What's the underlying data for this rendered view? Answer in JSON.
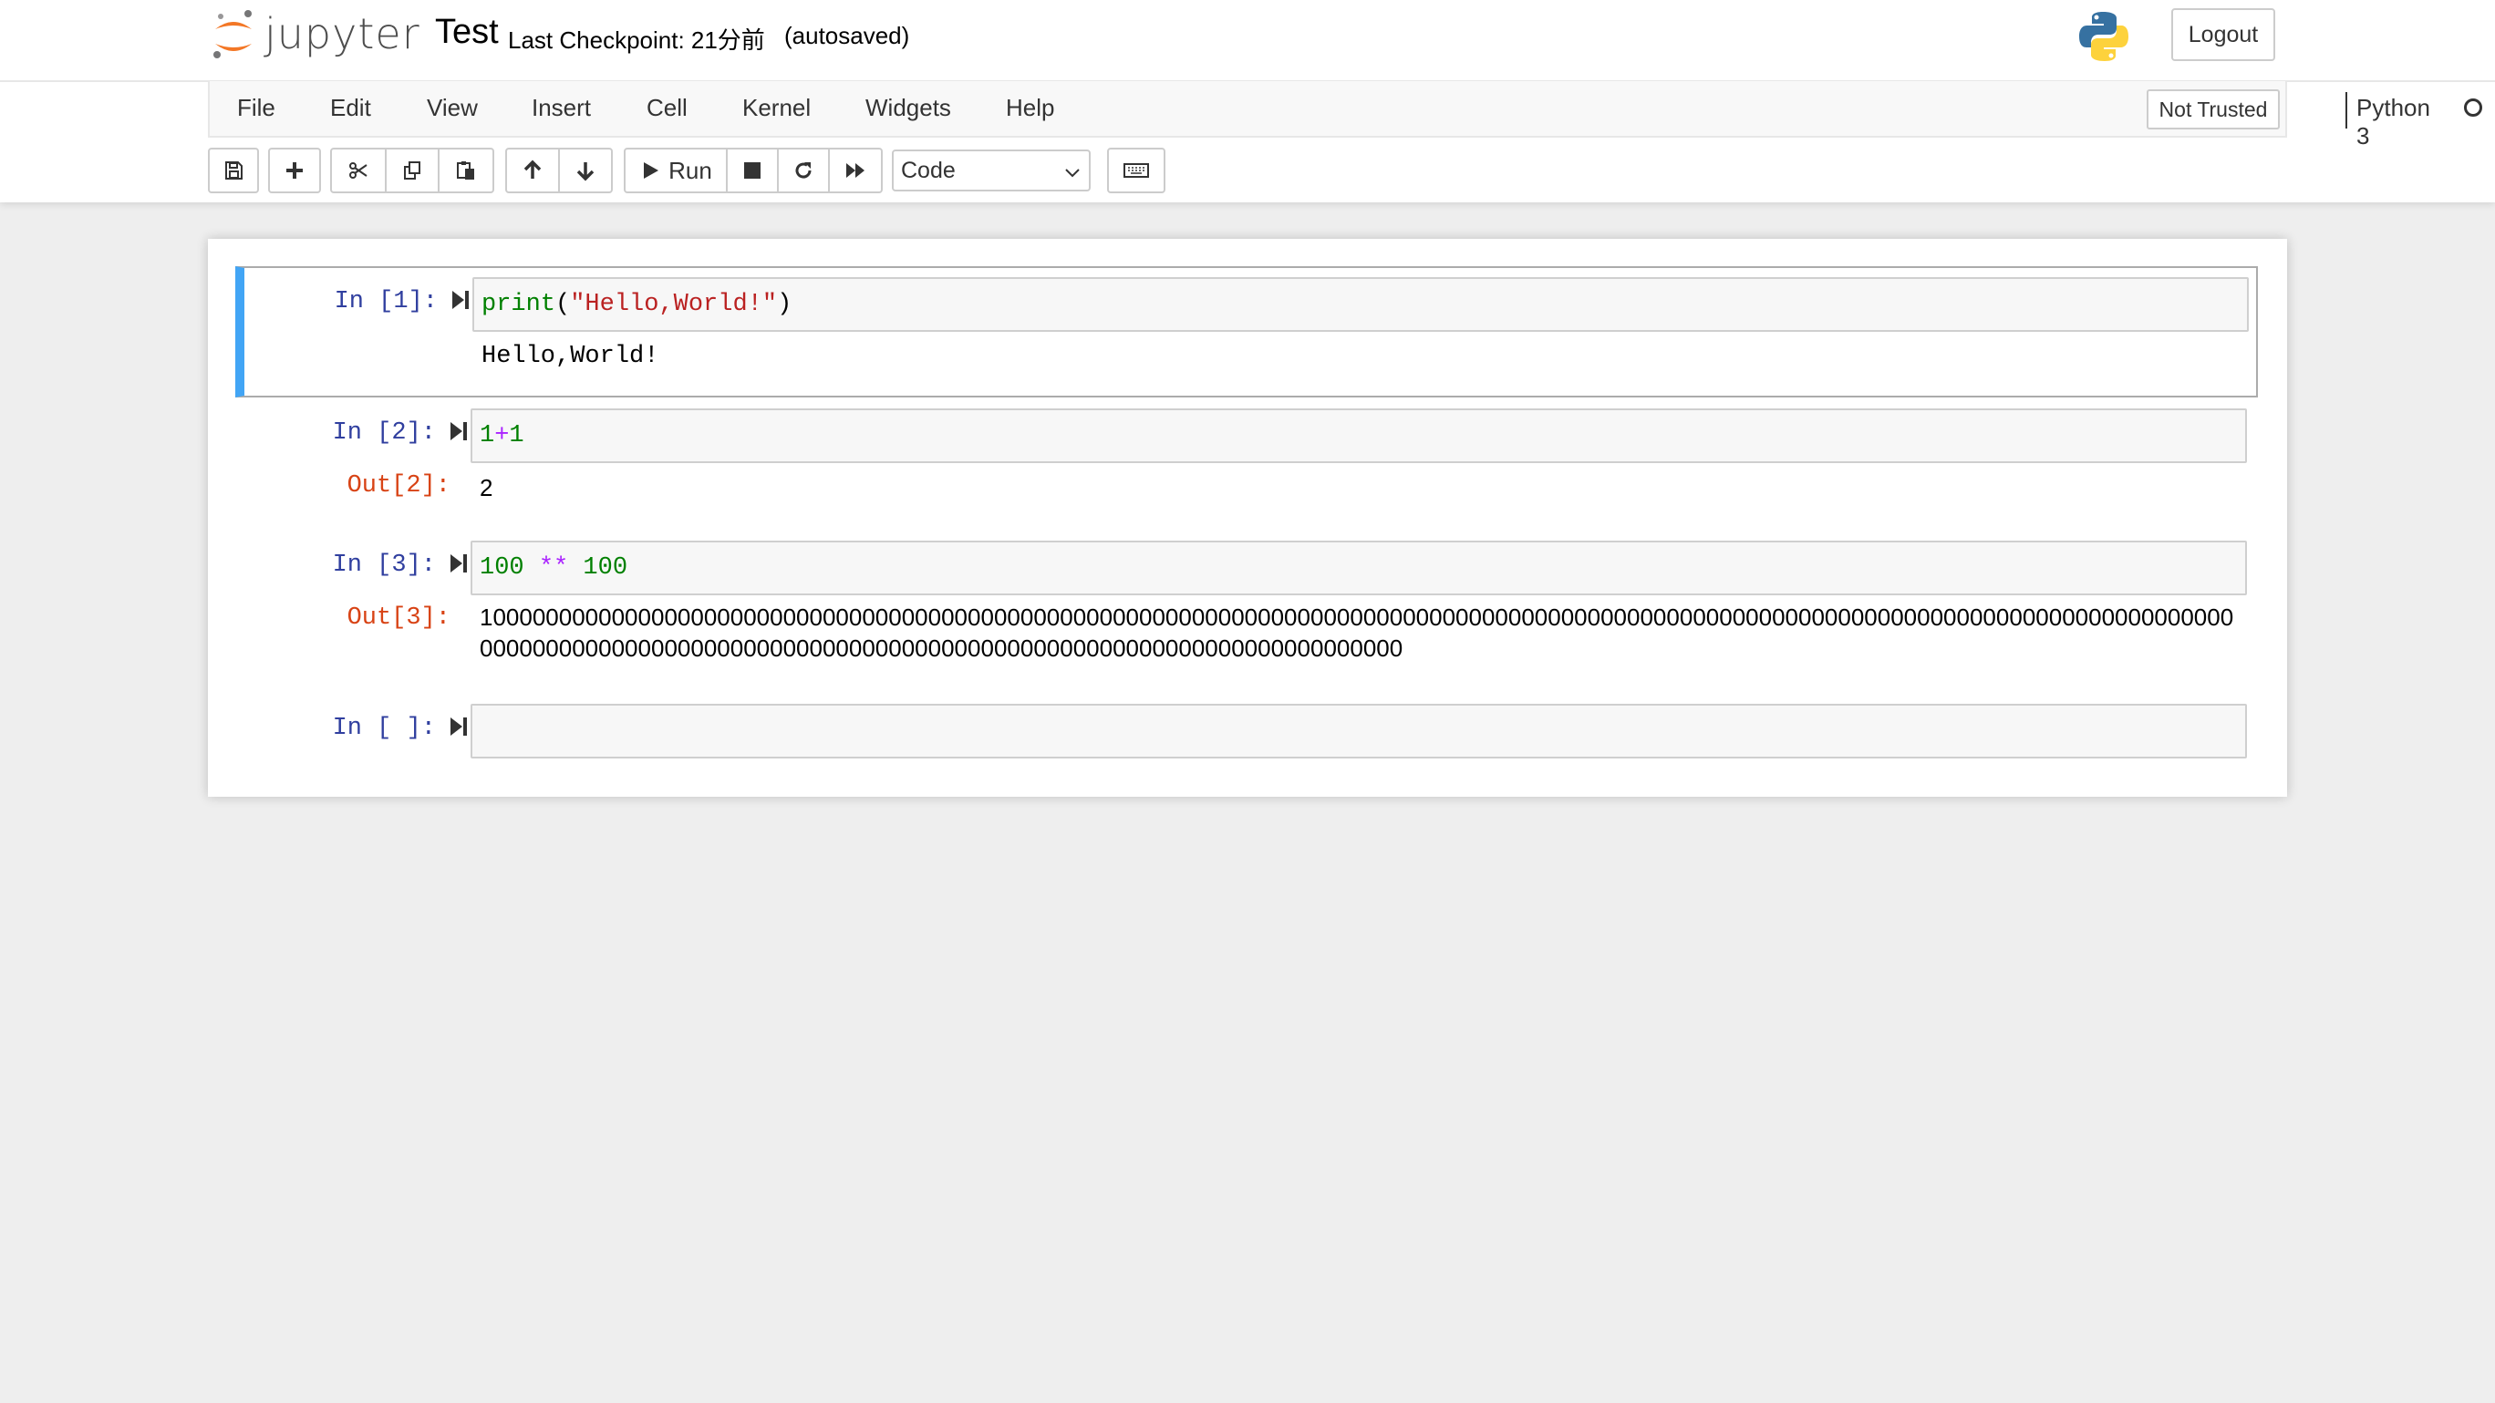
{
  "header": {
    "logo_text": "jupyter",
    "notebook_name": "Test",
    "checkpoint": "Last Checkpoint: 21分前",
    "autosave": "(autosaved)",
    "logout_label": "Logout"
  },
  "menubar": {
    "items": [
      "File",
      "Edit",
      "View",
      "Insert",
      "Cell",
      "Kernel",
      "Widgets",
      "Help"
    ],
    "trusted_label": "Not Trusted",
    "kernel_name": "Python 3"
  },
  "toolbar": {
    "run_label": "Run",
    "cell_type": "Code"
  },
  "cells": [
    {
      "in_prompt": "In [1]:",
      "code": {
        "fn": "print",
        "open": "(",
        "str": "\"Hello,World!\"",
        "close": ")"
      },
      "output": "Hello,World!"
    },
    {
      "in_prompt": "In [2]:",
      "code": {
        "a": "1",
        "op": "+",
        "b": "1"
      },
      "out_prompt": "Out[2]:",
      "output": "2"
    },
    {
      "in_prompt": "In [3]:",
      "code": {
        "a": "100",
        "op": "**",
        "b": "100"
      },
      "out_prompt": "Out[3]:",
      "output": "10000000000000000000000000000000000000000000000000000000000000000000000000000000000000000000000000000000000000000000000000000000000000000000000000000000000000000000000000000000000000000000000000000000000"
    },
    {
      "in_prompt": "In [ ]:"
    }
  ],
  "colors": {
    "selected_cell_border": "#42a5f5",
    "in_prompt": "#303f9f",
    "out_prompt": "#d84315",
    "builtin": "#008000",
    "string": "#ba2121",
    "operator": "#aa22ff"
  }
}
